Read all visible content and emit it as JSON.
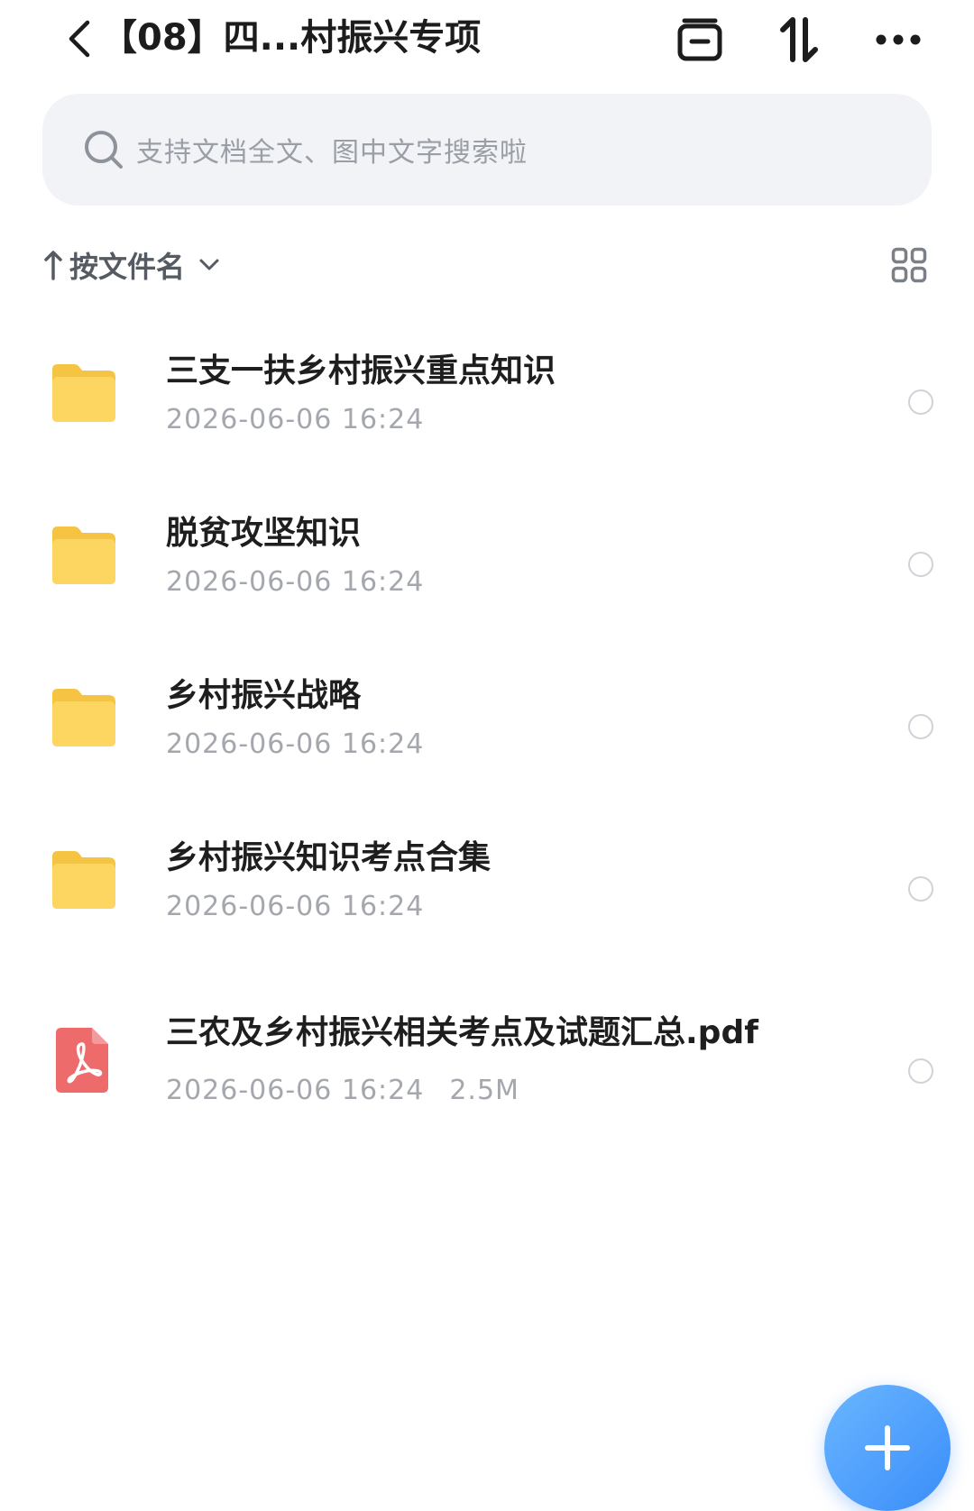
{
  "header": {
    "title": "【08】四...村振兴专项",
    "icons": [
      "back-icon",
      "box-icon",
      "sort-icon",
      "more-icon"
    ]
  },
  "search": {
    "placeholder": "支持文档全文、图中文字搜索啦"
  },
  "sort": {
    "label": "按文件名",
    "direction": "ascending"
  },
  "files": [
    {
      "name": "三支一扶乡村振兴重点知识",
      "date": "2026-06-06 16:24",
      "size": "",
      "type": "folder"
    },
    {
      "name": "脱贫攻坚知识",
      "date": "2026-06-06 16:24",
      "size": "",
      "type": "folder"
    },
    {
      "name": "乡村振兴战略",
      "date": "2026-06-06 16:24",
      "size": "",
      "type": "folder"
    },
    {
      "name": "乡村振兴知识考点合集",
      "date": "2026-06-06 16:24",
      "size": "",
      "type": "folder"
    },
    {
      "name": "三农及乡村振兴相关考点及试题汇总.pdf",
      "date": "2026-06-06 16:24",
      "size": "2.5M",
      "type": "pdf"
    }
  ],
  "colors": {
    "folder": "#fcd45c",
    "pdf": "#ee6b6b",
    "accent": "#3a8dfa"
  }
}
